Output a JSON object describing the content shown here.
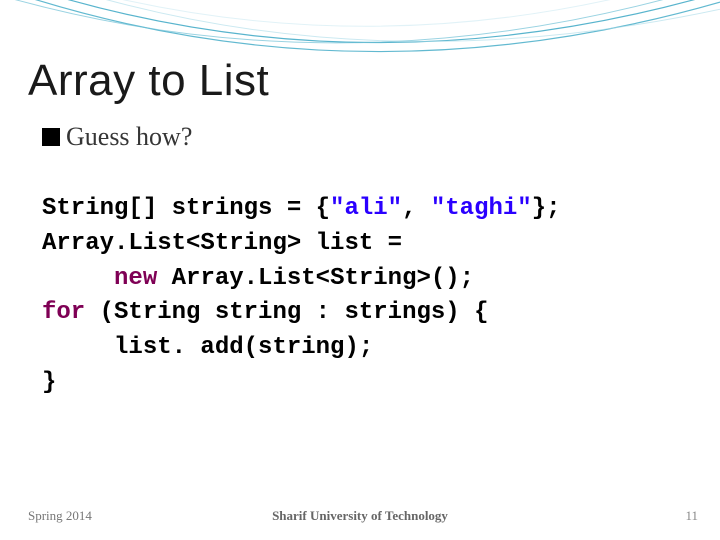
{
  "title": "Array to List",
  "subtitle": "Guess how?",
  "code": {
    "l1a": "String[] strings = {",
    "l1s1": "\"ali\"",
    "l1b": ", ",
    "l1s2": "\"taghi\"",
    "l1c": "};",
    "l2": "Array.List<String> list = ",
    "l3a": "     ",
    "l3kw": "new",
    "l3b": " Array.List<String>();",
    "l4kw": "for",
    "l4": " (String string : strings) {",
    "l5": "     list. add(string);",
    "l6": "}"
  },
  "footer": {
    "left": "Spring 2014",
    "center": "Sharif University of Technology",
    "right": "11"
  }
}
